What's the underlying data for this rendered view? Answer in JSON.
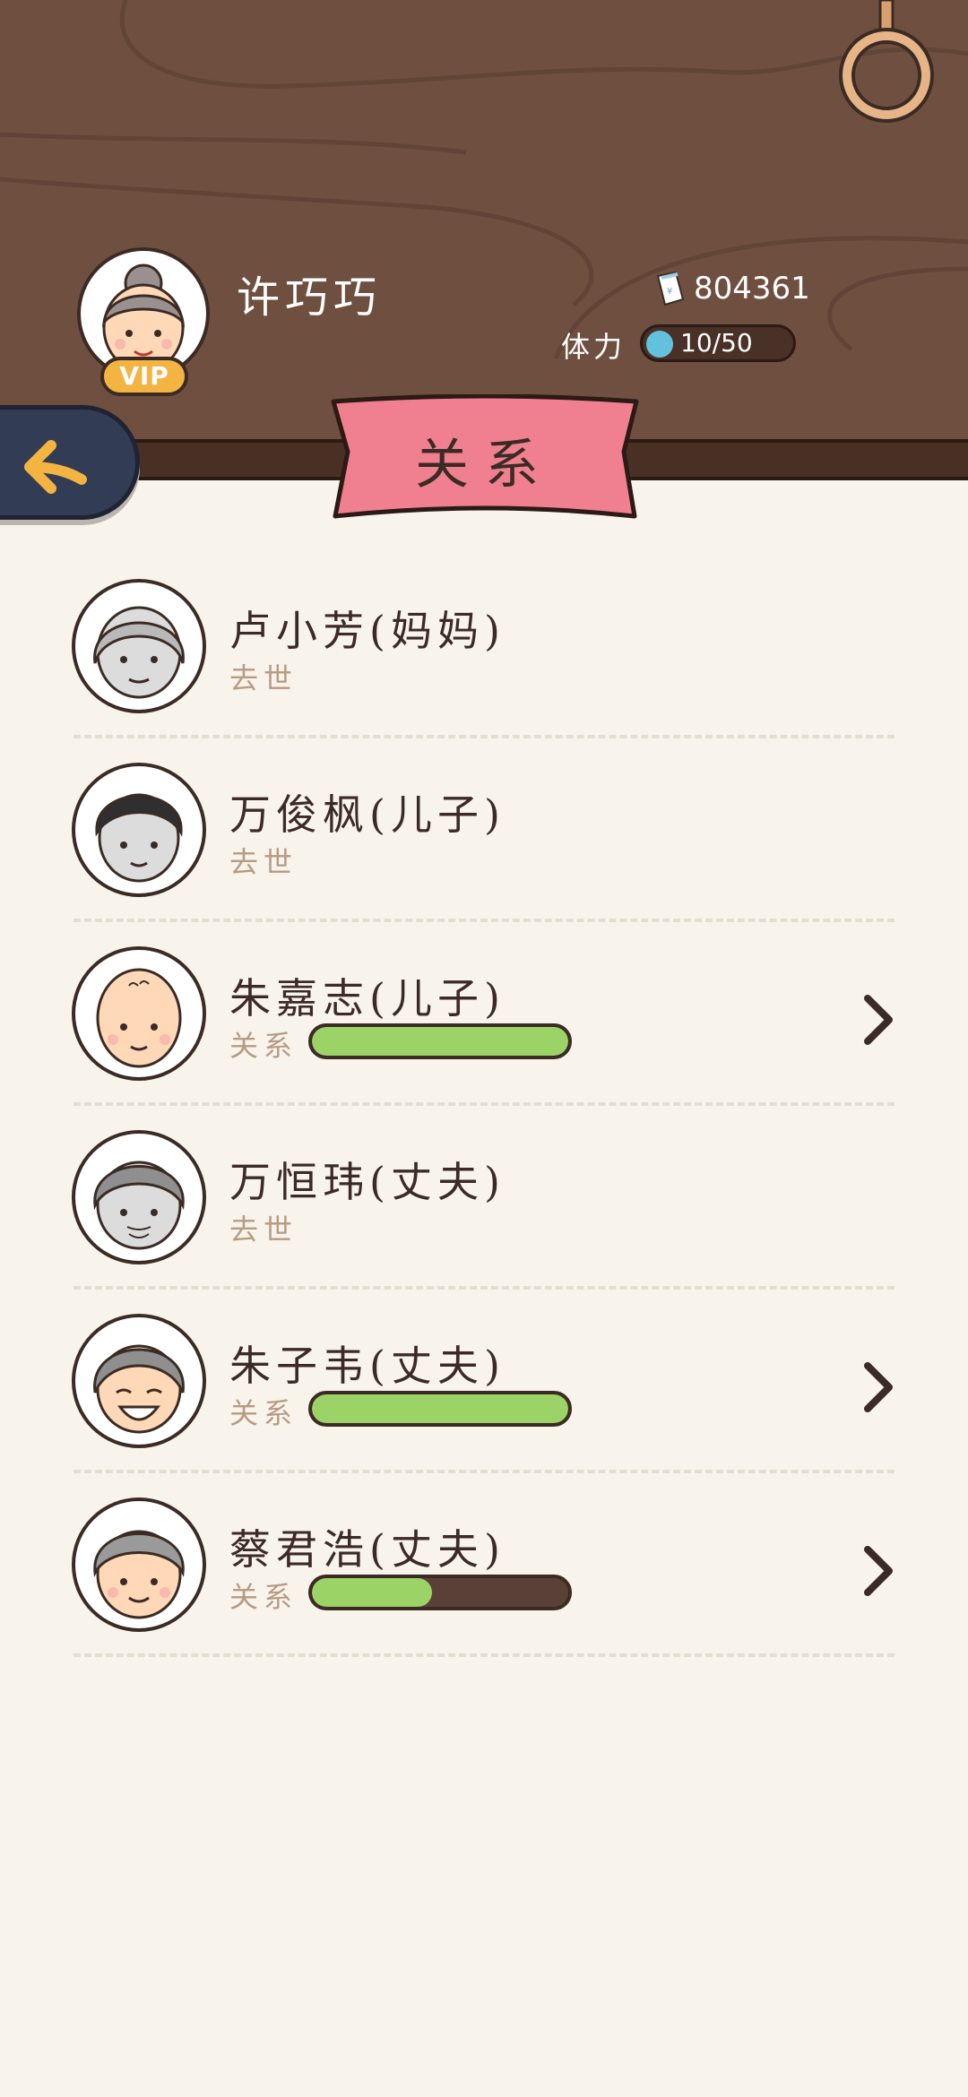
{
  "header": {
    "player_name": "许巧巧",
    "vip_label": "VIP",
    "money": "804361",
    "stamina_label": "体力",
    "stamina_value": "10/50"
  },
  "page": {
    "title": "关系"
  },
  "relations": [
    {
      "name": "卢小芳(妈妈)",
      "status": "去世",
      "alive": false,
      "relation_level": null
    },
    {
      "name": "万俊枫(儿子)",
      "status": "去世",
      "alive": false,
      "relation_level": null
    },
    {
      "name": "朱嘉志(儿子)",
      "status": "关系",
      "alive": true,
      "relation_level": 1.0
    },
    {
      "name": "万恒玮(丈夫)",
      "status": "去世",
      "alive": false,
      "relation_level": null
    },
    {
      "name": "朱子韦(丈夫)",
      "status": "关系",
      "alive": true,
      "relation_level": 1.0
    },
    {
      "name": "蔡君浩(丈夫)",
      "status": "关系",
      "alive": true,
      "relation_level": 0.47
    }
  ],
  "colors": {
    "header_wood": "#6f4f40",
    "ribbon_pink": "#f0808f",
    "bar_green": "#9bd366",
    "page_bg": "#f8f4ec"
  }
}
